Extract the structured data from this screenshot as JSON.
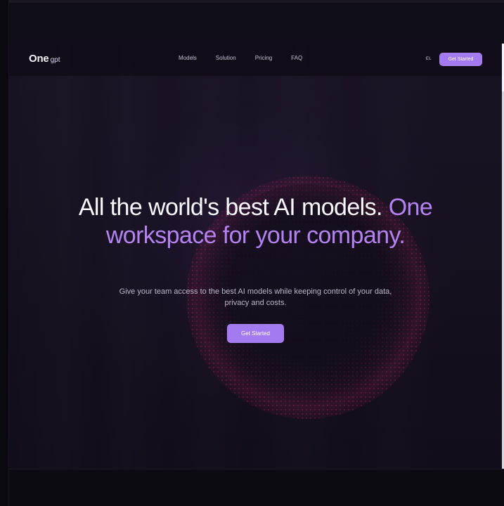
{
  "logo": {
    "main": "One",
    "sub": "gpt"
  },
  "nav": {
    "links": [
      "Models",
      "Solution",
      "Pricing",
      "FAQ"
    ],
    "language": "EL",
    "cta": "Get Started"
  },
  "hero": {
    "title_part_1": "All the world's best AI models.",
    "title_part_2": "One workspace for your company.",
    "subtitle": "Give your team access to the best AI models while keeping control of your data, privacy and costs.",
    "cta": "Get Started"
  },
  "colors": {
    "background": "#120d19",
    "accent": "#a47af0",
    "headline_accent": "#b483f1",
    "text_primary": "#faf8ff",
    "text_secondary": "#bcb5c8",
    "glow": "#ba225d"
  },
  "icons": {
    "scrollbar": "scrollbar"
  }
}
